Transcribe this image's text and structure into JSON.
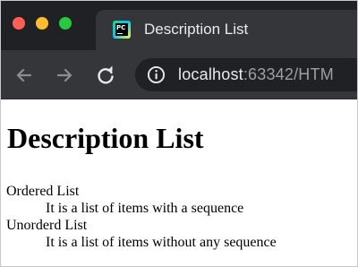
{
  "browser": {
    "tab": {
      "title": "Description List",
      "favicon": "pycharm-icon",
      "favicon_text": "PC"
    },
    "toolbar": {
      "back_icon": "arrow-left-icon",
      "forward_icon": "arrow-right-icon",
      "reload_icon": "reload-icon",
      "info_icon": "info-icon"
    },
    "address": {
      "host": "localhost",
      "rest": ":63342/HTM"
    },
    "colors": {
      "tabstrip": "#202124",
      "toolbar": "#35363a",
      "close": "#ff5f57",
      "minimize": "#febc2e",
      "maximize": "#28c840"
    }
  },
  "page": {
    "heading": "Description List",
    "items": [
      {
        "term": "Ordered List",
        "description": "It is a list of items with a sequence"
      },
      {
        "term": "Unorderd List",
        "description": "It is a list of items without any sequence"
      }
    ]
  }
}
